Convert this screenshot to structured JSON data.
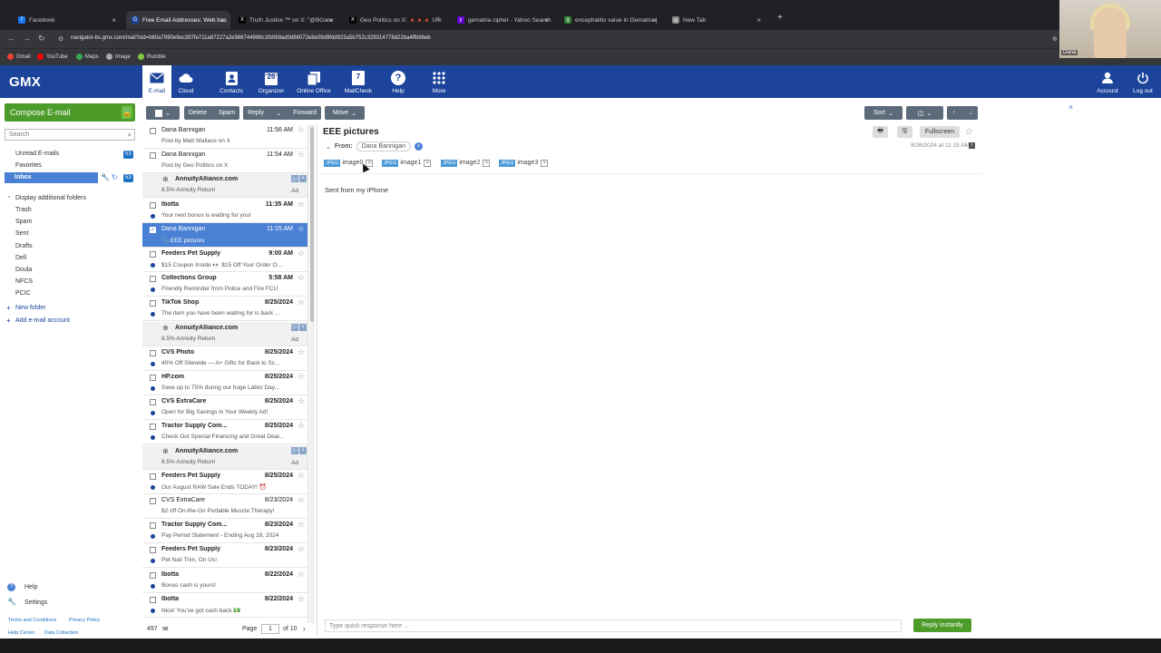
{
  "browser": {
    "tabs": [
      {
        "label": "Facebook",
        "color": "#1877f2",
        "glyph": "f"
      },
      {
        "label": "Free Email Addresses: Web bas",
        "color": "#1c449b",
        "glyph": "G"
      },
      {
        "label": "Truth Justice ™ on X: \"@BGate",
        "color": "#000000",
        "glyph": "X"
      },
      {
        "label": "Geo Politics on X: 🔺🔺🔺 UF",
        "color": "#000000",
        "glyph": "X"
      },
      {
        "label": "gematria cipher - Yahoo Search",
        "color": "#6001d2",
        "glyph": "y"
      },
      {
        "label": "encephalitis value in Gematria |",
        "color": "#2e7d32",
        "glyph": "g"
      },
      {
        "label": "New Tab",
        "color": "#888888",
        "glyph": "◎"
      }
    ],
    "new_tab": "+",
    "url": "navigator-bs.gmx.com/mail?sid=b60a7990e9ec397fe711a87227a2e986744998c1fb069ad0d86072e8e09d9fdd923a5b752c329314778d22ba4ffb96eb",
    "bookmarks": [
      {
        "label": "Gmail",
        "color": "#ea4335"
      },
      {
        "label": "YouTube",
        "color": "#ff0000"
      },
      {
        "label": "Maps",
        "color": "#34a853"
      },
      {
        "label": "Image",
        "color": "#aaaaaa"
      },
      {
        "label": "Rumble",
        "color": "#85c742"
      }
    ]
  },
  "webcam": {
    "name": "Dana"
  },
  "gmx": {
    "logo": "GMX",
    "nav": [
      {
        "label": "E-mail",
        "icon": "envelope-icon"
      },
      {
        "label": "Cloud",
        "icon": "cloud-icon"
      },
      {
        "label": "Contacts",
        "icon": "contacts-icon"
      },
      {
        "label": "Organizer",
        "icon": "calendar-icon",
        "badge": "26"
      },
      {
        "label": "Online Office",
        "icon": "office-icon"
      },
      {
        "label": "MailCheck",
        "icon": "mailcheck-icon",
        "badge": "7"
      },
      {
        "label": "Help",
        "icon": "help-icon",
        "badge": "?"
      },
      {
        "label": "More",
        "icon": "grid-icon"
      }
    ],
    "account": "Account",
    "logout": "Log out"
  },
  "sidebar": {
    "compose": "Compose E-mail",
    "search_placeholder": "Search",
    "unread": {
      "label": "Unread E-mails",
      "count": "53"
    },
    "favorites": "Favorites",
    "inbox": {
      "label": "Inbox",
      "count": "53"
    },
    "display_additional": "Display additional folders",
    "folders": [
      "Trash",
      "Spam",
      "Sent",
      "Drafts",
      "Dell",
      "Doula",
      "NFCS",
      "PCIC"
    ],
    "new_folder": "New folder",
    "add_account": "Add e-mail account",
    "help": "Help",
    "settings": "Settings",
    "footer_links": [
      "Terms and Conditions",
      "Privacy Policy",
      "Help Center",
      "Data Collection"
    ]
  },
  "toolbar": {
    "delete": "Delete",
    "spam": "Spam",
    "reply": "Reply",
    "forward": "Forward",
    "move": "Move",
    "sort": "Sort"
  },
  "messages": [
    {
      "from": "Dana Bannigan",
      "date": "11:56 AM",
      "subject": "Post by Matt Wallace on X",
      "unread": false,
      "type": "mail"
    },
    {
      "from": "Dana Bannigan",
      "date": "11:54 AM",
      "subject": "Post by Geo Politics on X",
      "unread": false,
      "type": "mail"
    },
    {
      "from": "AnnuityAlliance.com",
      "date": "",
      "subject": "8.5% Annuity Return",
      "unread": false,
      "type": "ad"
    },
    {
      "from": "Ibotta",
      "date": "11:35 AM",
      "subject": "Your next bonus is waiting for you!",
      "unread": true,
      "type": "mail"
    },
    {
      "from": "Dana Bannigan",
      "date": "11:15 AM",
      "subject": "📎 EEE pictures",
      "unread": false,
      "type": "selected"
    },
    {
      "from": "Feeders Pet Supply",
      "date": "9:00 AM",
      "subject": "$15 Coupon Inside 👀 $15 Off Your Order O...",
      "unread": true,
      "type": "mail"
    },
    {
      "from": "Collections Group",
      "date": "5:58 AM",
      "subject": "Friendly Reminder from Police and Fire FCU",
      "unread": true,
      "type": "mail"
    },
    {
      "from": "TikTok Shop",
      "date": "8/25/2024",
      "subject": "The item you have been waiting for is back ...",
      "unread": true,
      "type": "mail"
    },
    {
      "from": "AnnuityAlliance.com",
      "date": "",
      "subject": "8.5% Annuity Return",
      "unread": false,
      "type": "ad"
    },
    {
      "from": "CVS Photo",
      "date": "8/25/2024",
      "subject": "40% Off Sitewide — A+ Gifts for Back to Sc...",
      "unread": true,
      "type": "mail"
    },
    {
      "from": "HP.com",
      "date": "8/25/2024",
      "subject": "Save up to 75% during our huge Labor Day...",
      "unread": true,
      "type": "mail"
    },
    {
      "from": "CVS ExtraCare",
      "date": "8/25/2024",
      "subject": "Open for Big Savings in Your Weekly Ad!",
      "unread": true,
      "type": "mail"
    },
    {
      "from": "Tractor Supply Com...",
      "date": "8/25/2024",
      "subject": "Check Out Special Financing and Great Deal...",
      "unread": true,
      "type": "mail"
    },
    {
      "from": "AnnuityAlliance.com",
      "date": "",
      "subject": "8.5% Annuity Return",
      "unread": false,
      "type": "ad"
    },
    {
      "from": "Feeders Pet Supply",
      "date": "8/25/2024",
      "subject": "Our August RAW Sale Ends TODAY! ⏰",
      "unread": true,
      "type": "mail"
    },
    {
      "from": "CVS ExtraCare",
      "date": "8/23/2024",
      "subject": "$2 off On-the-Go Portable Muscle Therapy!",
      "unread": false,
      "type": "mail"
    },
    {
      "from": "Tractor Supply Com...",
      "date": "8/23/2024",
      "subject": "Pay Period Statement - Ending Aug 18, 2024",
      "unread": true,
      "type": "mail"
    },
    {
      "from": "Feeders Pet Supply",
      "date": "8/23/2024",
      "subject": "Pet Nail Trim, On Us!",
      "unread": true,
      "type": "mail"
    },
    {
      "from": "Ibotta",
      "date": "8/22/2024",
      "subject": "Bonus cash is yours!",
      "unread": true,
      "type": "mail"
    },
    {
      "from": "Ibotta",
      "date": "8/22/2024",
      "subject": "Nice! You've got cash back 💵",
      "unread": true,
      "type": "mail"
    }
  ],
  "ad_label": "Ad",
  "list_footer": {
    "count": "497",
    "page_label": "Page",
    "page": "1",
    "of": "of 10"
  },
  "reading": {
    "subject": "EEE pictures",
    "from_label": "From:",
    "sender": "Dana Bannigan",
    "datetime": "8/26/2024 at 11:15 AM",
    "fullscreen": "Fullscreen",
    "attachments": [
      {
        "type": "JPEG",
        "name": "image0"
      },
      {
        "type": "JPEG",
        "name": "image1"
      },
      {
        "type": "JPEG",
        "name": "image2"
      },
      {
        "type": "JPEG",
        "name": "image3"
      }
    ],
    "body": "Sent from my iPhone",
    "quick_placeholder": "Type quick response here ...",
    "reply_button": "Reply instantly"
  }
}
